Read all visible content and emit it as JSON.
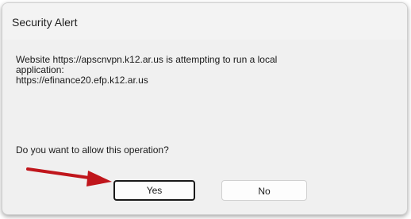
{
  "dialog": {
    "title": "Security Alert",
    "message_lines": [
      "Website https://apscnvpn.k12.ar.us is attempting to run a local",
      "application:",
      "https://efinance20.efp.k12.ar.us"
    ],
    "question": "Do you want to allow this operation?",
    "yes_label": "Yes",
    "no_label": "No"
  },
  "annotation": {
    "arrow_icon": "red-arrow-pointing-right",
    "arrow_color": "#c0161c"
  }
}
